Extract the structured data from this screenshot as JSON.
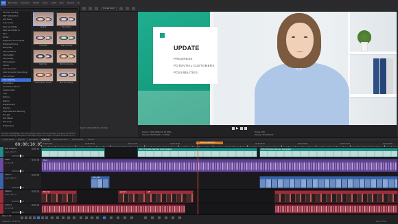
{
  "fx_browser": {
    "tabs": [
      "All",
      "Favorites",
      "Creative",
      "Utility",
      "Color",
      "Light",
      "Blur",
      "Distort",
      "Noise",
      "Stylize"
    ],
    "active_tab": "All",
    "plugins": [
      "3D Color Grading",
      "360° Stabilization",
      "Add Noise",
      "Auto Levels",
      "Black and White",
      "Black and White Fx",
      "Blurs",
      "Border",
      "Brightness and Contrast",
      "Broadcast Colors",
      "Bump Map",
      "Channel Blend",
      "Chroma Blur",
      "Chroma Key",
      "Chroma Keyer",
      "Clouds",
      "Color Corrector",
      "Color Corrector (Secondary)",
      "Color Curves",
      "Color Grading",
      "Colorization",
      "Convolution Kernel",
      "Cookie Cutter",
      "Crop",
      "Defocus",
      "Deform",
      "Displacement",
      "Dissolve",
      "Edge Detection Warming",
      "Fill Light",
      "Film Effects",
      "Film Grain",
      "Fractal Glow"
    ],
    "selected_plugin": "Color Grading",
    "presets": [
      "Default",
      "Blue Kelvin",
      "Cross Mix",
      "Teal & Orange",
      "Night Sky",
      "Warming Sunrise",
      "South Pacific Sunset",
      "Blue and Orange"
    ],
    "selected_preset": "Default",
    "status": "3D Color Grade Maker: OFX, 32-bit floating point, GPU Accelerated, Grouping: OFX\\VEGAS Pro\\Color Grading\\ Description: Post Magic Plugin from Magix. Computer Products Intl, Inc."
  },
  "preview": {
    "quality_label": "Preview (Auto)",
    "slide": {
      "title": "UPDATE",
      "lines": [
        "PROGRESS",
        "POTENTIAL CUSTOMERS",
        "POSSIBILITIES"
      ],
      "accent_color": "#18a383"
    },
    "info": {
      "project": "Project: 1920x1080x32, 25,000p",
      "preview": "Preview: 960x540x32, 25,000p",
      "frame": "Frame: 258",
      "display": "Display: 434x244x32",
      "video_preview": "Video Preview"
    },
    "left_info": "Project: 1920x1080x32, 25,000p"
  },
  "pane_tabs": [
    "Project Media",
    "Explorer",
    "Transitions",
    "Video FX",
    "Media Generators",
    "Video Preview",
    "Trimmer"
  ],
  "active_pane_tab": "Video FX",
  "timeline": {
    "timecode": "00:00:10:05",
    "marker_label": "Marker placement",
    "ruler_labels": [
      "00:00:00:00",
      "00:00:05:00",
      "00:00:10:00",
      "00:00:15:00",
      "00:00:20:00",
      "00:00:25:00",
      "00:00:30:00",
      "00:00:35:00",
      "00:00:40:00"
    ],
    "tracks": [
      {
        "num": "1",
        "name": "Text Graphics",
        "level": "Level: 100,0 %",
        "color": "#1f8e86"
      },
      {
        "num": "2",
        "name": "Audio",
        "level": "Vol: 0,0 dB",
        "color": "#6b4aa0"
      },
      {
        "num": "3",
        "name": "Video 1",
        "level": "Level: 100,0 %",
        "color": "#3a63a8"
      },
      {
        "num": "4",
        "name": "Video 2",
        "level": "Level: 100,0 %",
        "color": "#9b2e3c"
      },
      {
        "num": "5",
        "name": "Audio 2",
        "level": "Vol: 0,0 dB",
        "color": "#9b2e3c"
      }
    ],
    "clip_labels": {
      "title_a": "Mirror Title Text Advanced: project graphics",
      "title_b": "Mirror Title Text Advanced: post graphic",
      "audio": "Track",
      "video_a": "DSC_0001",
      "red_a": "film.mp4",
      "red_b": "joy.mp4",
      "red_c": "gift"
    }
  },
  "bottom_bar": {
    "rate": "Rate: 0,00",
    "timecode": "Complete: 00:00:02",
    "record_time": "Record Time"
  }
}
